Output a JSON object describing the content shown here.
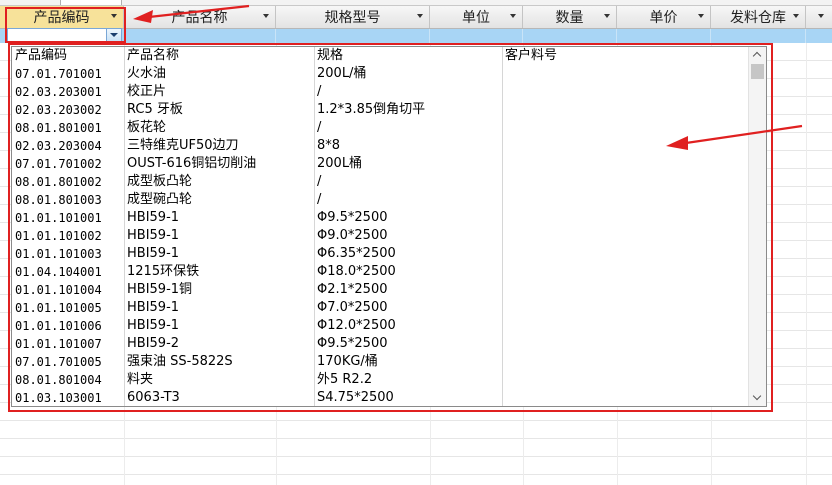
{
  "header": {
    "columns": [
      {
        "label": "产品编码"
      },
      {
        "label": "产品名称"
      },
      {
        "label": "规格型号"
      },
      {
        "label": "单位"
      },
      {
        "label": "数量"
      },
      {
        "label": "单价"
      },
      {
        "label": "发料仓库"
      },
      {
        "label": ""
      }
    ]
  },
  "filter": {
    "value": ""
  },
  "dropdown": {
    "headers": [
      "产品编码",
      "产品名称",
      "规格",
      "客户料号"
    ],
    "rows": [
      [
        "07.01.701001",
        "火水油",
        "200L/桶",
        ""
      ],
      [
        "02.03.203001",
        "校正片",
        "/",
        ""
      ],
      [
        "02.03.203002",
        "RC5 牙板",
        "1.2*3.85倒角切平",
        ""
      ],
      [
        "08.01.801001",
        "板花轮",
        "/",
        ""
      ],
      [
        "02.03.203004",
        "三特维克UF50边刀",
        "8*8",
        ""
      ],
      [
        "07.01.701002",
        "OUST-616铜铝切削油",
        "200L桶",
        ""
      ],
      [
        "08.01.801002",
        "成型板凸轮",
        "/",
        ""
      ],
      [
        "08.01.801003",
        "成型碗凸轮",
        "/",
        ""
      ],
      [
        "01.01.101001",
        "HBI59-1",
        "Φ9.5*2500",
        ""
      ],
      [
        "01.01.101002",
        "HBI59-1",
        "Φ9.0*2500",
        ""
      ],
      [
        "01.01.101003",
        "HBI59-1",
        "Φ6.35*2500",
        ""
      ],
      [
        "01.04.104001",
        "1215环保铁",
        "Φ18.0*2500",
        ""
      ],
      [
        "01.01.101004",
        "HBI59-1铜",
        "Φ2.1*2500",
        ""
      ],
      [
        "01.01.101005",
        "HBI59-1",
        "Φ7.0*2500",
        ""
      ],
      [
        "01.01.101006",
        "HBI59-1",
        "Φ12.0*2500",
        ""
      ],
      [
        "01.01.101007",
        "HBI59-2",
        "Φ9.5*2500",
        ""
      ],
      [
        "07.01.701005",
        "强束油 SS-5822S",
        "170KG/桶",
        ""
      ],
      [
        "08.01.801004",
        "料夹",
        "外5 R2.2",
        ""
      ],
      [
        "01.03.103001",
        "6063-T3",
        "S4.75*2500",
        ""
      ]
    ]
  },
  "colors": {
    "active_header": "#f7e29a",
    "filter_row": "#a8d5f5",
    "annotation_red": "#e02020"
  }
}
